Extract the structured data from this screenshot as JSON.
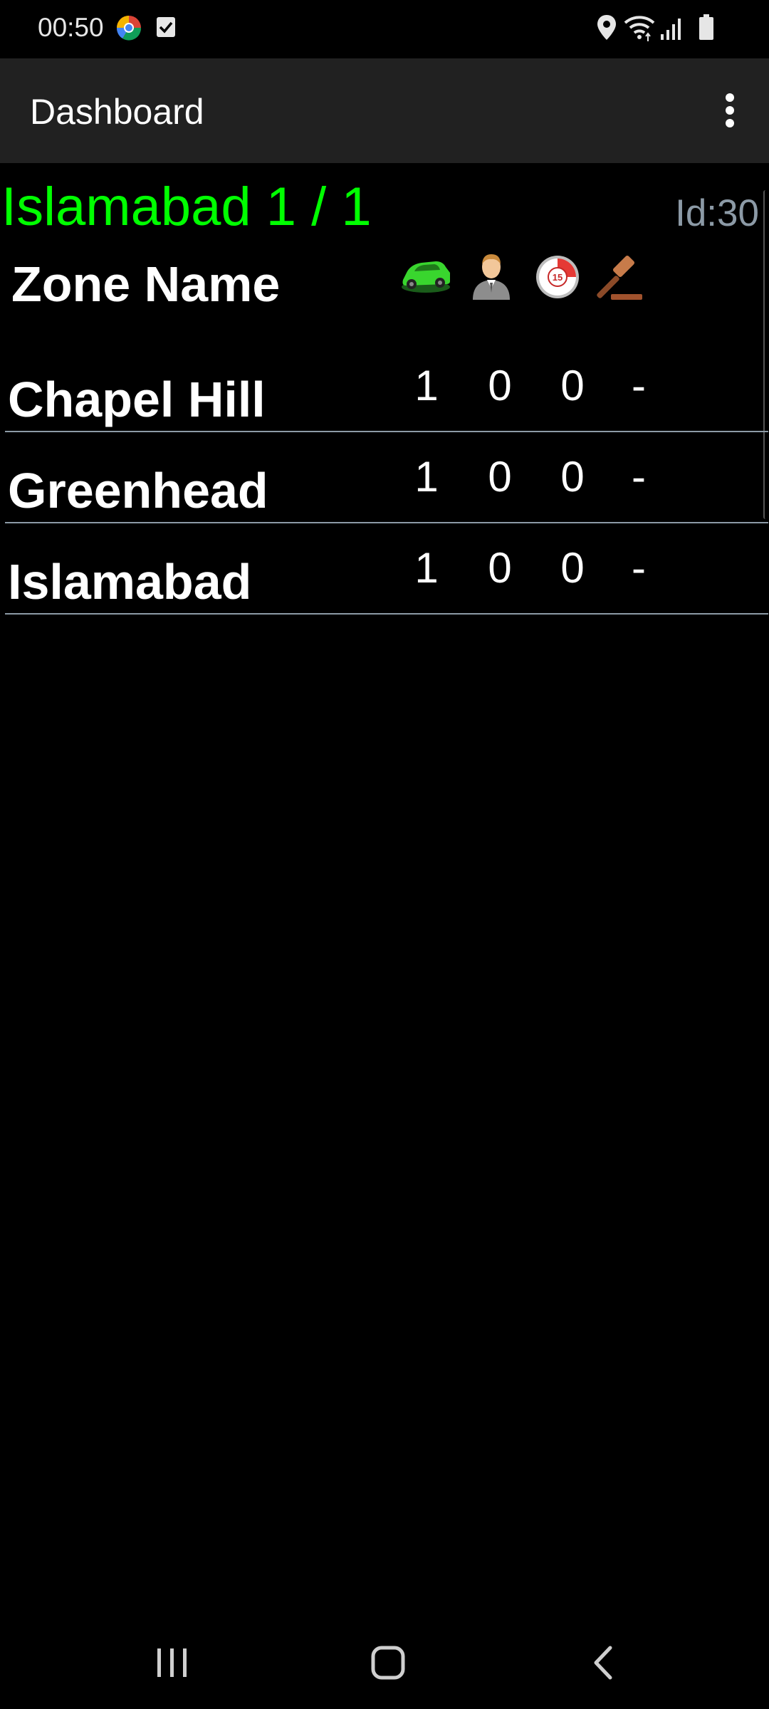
{
  "status_bar": {
    "time": "00:50",
    "left_icons": [
      "chrome-icon",
      "checkbox-notification-icon"
    ],
    "right_icons": [
      "location-icon",
      "wifi-icon",
      "signal-icon",
      "battery-icon"
    ]
  },
  "app_bar": {
    "title": "Dashboard",
    "menu_icon": "more-vertical-icon"
  },
  "header": {
    "zone_title": "Islamabad 1 / 1",
    "id_label": "Id:30",
    "zone_name_label": "Zone Name",
    "column_icons": [
      "car-icon",
      "person-icon",
      "timer-15-icon",
      "gavel-icon"
    ]
  },
  "zones": [
    {
      "name": "Chapel Hill",
      "cars": "1",
      "people": "0",
      "timer": "0",
      "gavel": "-"
    },
    {
      "name": "Greenhead",
      "cars": "1",
      "people": "0",
      "timer": "0",
      "gavel": "-"
    },
    {
      "name": "Islamabad",
      "cars": "1",
      "people": "0",
      "timer": "0",
      "gavel": "-"
    }
  ],
  "nav_bar": {
    "icons": [
      "recent-apps-icon",
      "home-icon",
      "back-icon"
    ]
  },
  "colors": {
    "zone_title": "#00ff00",
    "id_label": "#8c9aa6",
    "divider": "#8c9aa6",
    "app_bar_bg": "#212121",
    "background": "#000000"
  }
}
